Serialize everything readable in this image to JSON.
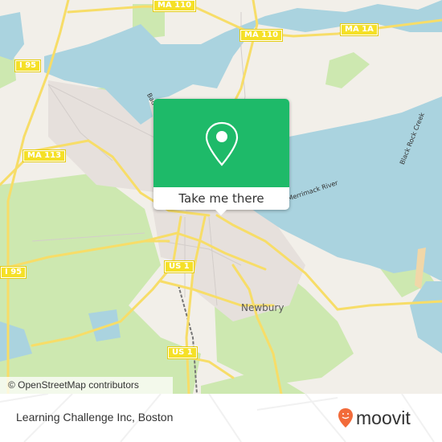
{
  "map": {
    "road_shields": [
      {
        "id": "ma-110-top",
        "label": "MA 110"
      },
      {
        "id": "ma-110-mid",
        "label": "MA 110"
      },
      {
        "id": "ma-1a",
        "label": "MA 1A"
      },
      {
        "id": "i-95-top",
        "label": "I 95"
      },
      {
        "id": "ma-113",
        "label": "MA 113"
      },
      {
        "id": "i-95-bottom",
        "label": "I 95"
      },
      {
        "id": "us-1-mid",
        "label": "US 1"
      },
      {
        "id": "us-1-bottom",
        "label": "US 1"
      }
    ],
    "places": [
      {
        "id": "newbury",
        "label": "Newbury"
      }
    ],
    "water_labels": [
      {
        "id": "merrimack-river",
        "label": "Merrimack River"
      },
      {
        "id": "black-rock-creek",
        "label": "Black Rock Creek"
      },
      {
        "id": "badgers",
        "label": "Bad"
      }
    ],
    "attribution": "© OpenStreetMap contributors"
  },
  "popup": {
    "icon": "map-pin-icon",
    "button_label": "Take me there",
    "color": "#1eba69"
  },
  "footer": {
    "title": "Learning Challenge Inc, Boston",
    "logo_text": "moovit",
    "logo_color": "#f26b3a"
  }
}
